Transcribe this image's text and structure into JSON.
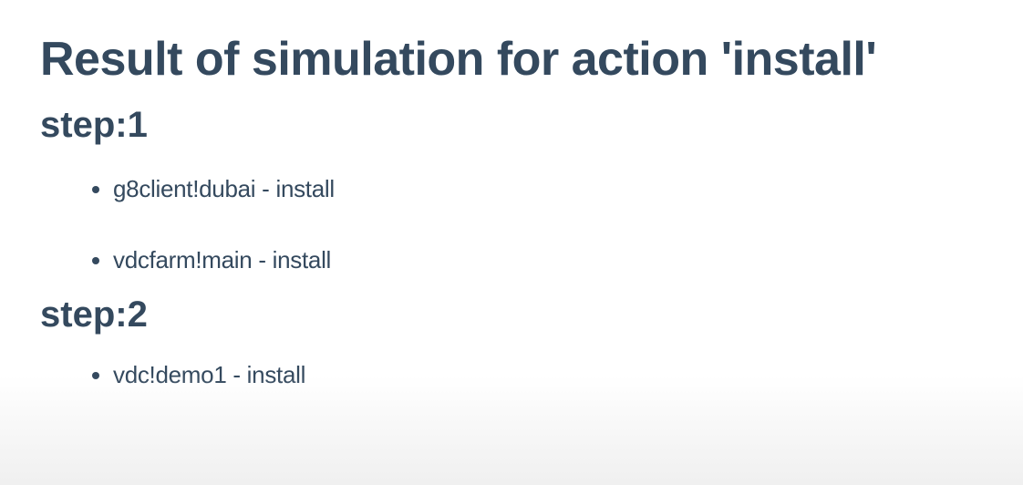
{
  "page": {
    "title": "Result of simulation for action 'install'"
  },
  "steps": [
    {
      "title": "step:1",
      "items": [
        "g8client!dubai - install",
        "vdcfarm!main - install"
      ]
    },
    {
      "title": "step:2",
      "items": [
        "vdc!demo1 - install"
      ]
    }
  ]
}
